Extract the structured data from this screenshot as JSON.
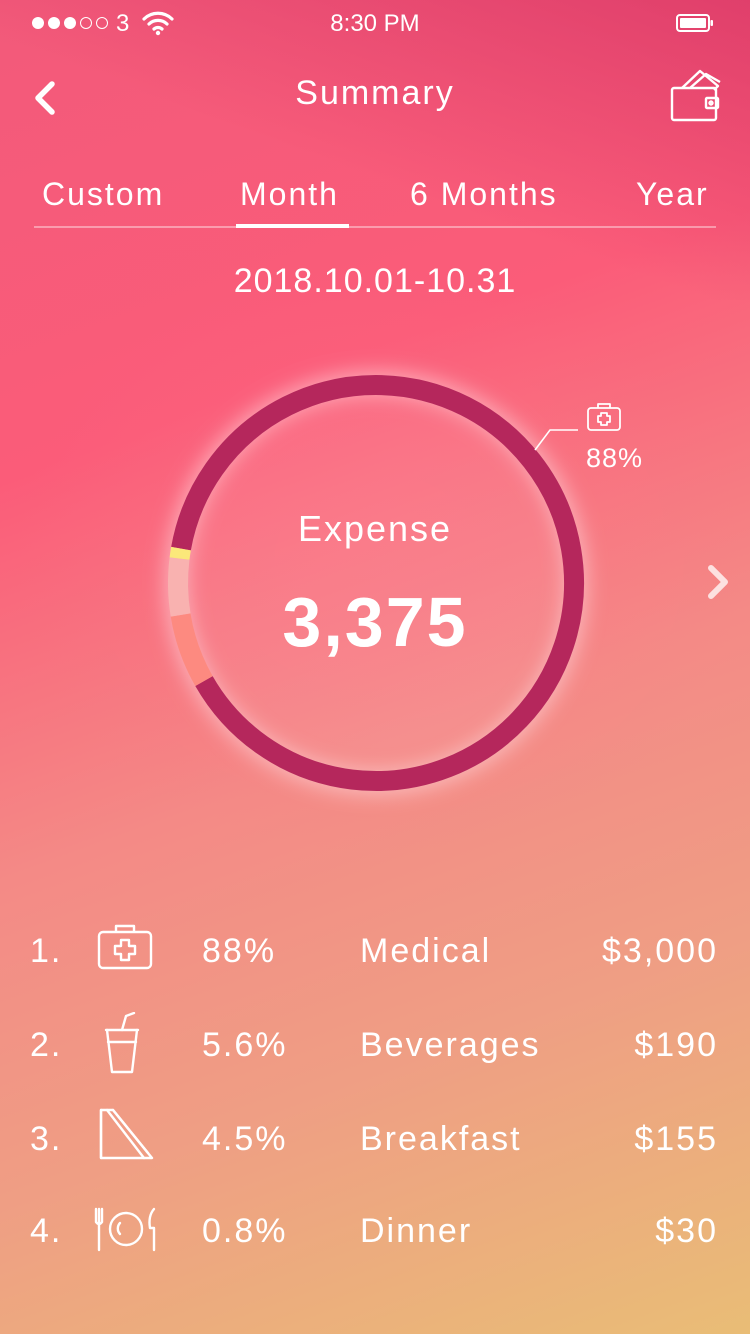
{
  "status_bar": {
    "carrier": "3",
    "time": "8:30 PM",
    "signal_dots_filled": 3,
    "signal_dots_total": 5
  },
  "header": {
    "title": "Summary",
    "back_icon": "chevron-left-icon",
    "wallet_icon": "wallet-icon"
  },
  "tabs": [
    {
      "label": "Custom",
      "active": false
    },
    {
      "label": "Month",
      "active": true
    },
    {
      "label": "6 Months",
      "active": false
    },
    {
      "label": "Year",
      "active": false
    }
  ],
  "date_range": "2018.10.01-10.31",
  "summary": {
    "label": "Expense",
    "total": "3,375",
    "callout_pct": "88%",
    "callout_icon": "medical-kit-icon"
  },
  "ring_segments": [
    {
      "category": "Medical",
      "share": 0.88,
      "color": "#b5275c"
    },
    {
      "category": "Beverages",
      "share": 0.056,
      "color": "#fd8a80"
    },
    {
      "category": "Breakfast",
      "share": 0.045,
      "color": "#f9b2b0"
    },
    {
      "category": "Dinner",
      "share": 0.008,
      "color": "#fbe87a"
    }
  ],
  "categories": [
    {
      "rank": "1.",
      "icon": "medical-kit-icon",
      "pct": "88%",
      "name": "Medical",
      "amount": "$3,000"
    },
    {
      "rank": "2.",
      "icon": "drink-cup-icon",
      "pct": "5.6%",
      "name": "Beverages",
      "amount": "$190"
    },
    {
      "rank": "3.",
      "icon": "sandwich-icon",
      "pct": "4.5%",
      "name": "Breakfast",
      "amount": "$155"
    },
    {
      "rank": "4.",
      "icon": "plate-cutlery-icon",
      "pct": "0.8%",
      "name": "Dinner",
      "amount": "$30"
    }
  ],
  "colors": {
    "ring_main": "#b5275c",
    "gradient_top": "#f25a7a",
    "gradient_bottom": "#e9bd76"
  }
}
